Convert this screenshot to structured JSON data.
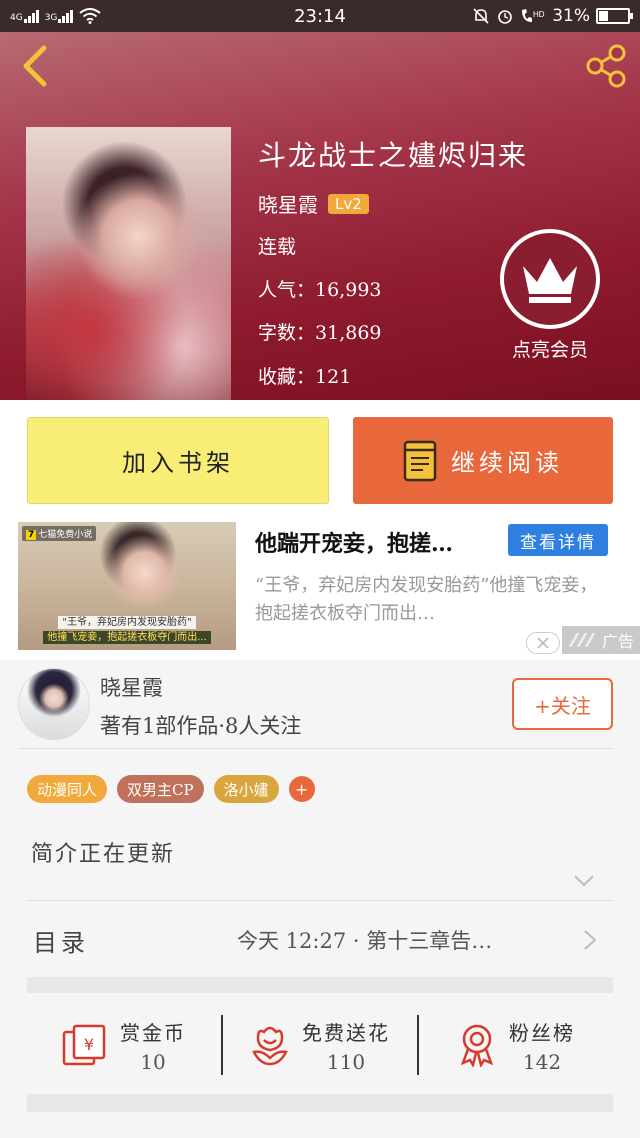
{
  "status_bar": {
    "time": "23:14",
    "net1": "4G",
    "net2": "3G",
    "battery": "31%"
  },
  "book": {
    "title": "斗龙战士之嫿烬归来",
    "author": "晓星霞",
    "level": "Lv2",
    "status": "连载",
    "popularity_label": "人气：",
    "popularity": "16,993",
    "words_label": "字数：",
    "words": "31,869",
    "favorites_label": "收藏：",
    "favorites": "121",
    "vip_label": "点亮会员"
  },
  "actions": {
    "shelf_label": "加入书架",
    "read_label": "继续阅读"
  },
  "ad": {
    "logo_text": "七猫免费小说",
    "caption_line1": "\"王爷，弃妃房内发现安胎药\"",
    "caption_line2": "他撞飞宠妾，抱起搓衣板夺门而出...",
    "title": "他踹开宠妾，抱搓…",
    "detail_label": "查看详情",
    "description": "“王爷，弃妃房内发现安胎药”他撞飞宠妾，抱起搓衣板夺门而出…",
    "tag": "广告"
  },
  "author_card": {
    "name": "晓星霞",
    "stats": "著有1部作品·8人关注",
    "follow_label": "+关注"
  },
  "tags": [
    {
      "label": "动漫同人",
      "color": "#f0a93a"
    },
    {
      "label": "双男主CP",
      "color": "#c0715c"
    },
    {
      "label": "洛小嫿",
      "color": "#d8a63c"
    }
  ],
  "tag_add": "+",
  "intro": "简介正在更新",
  "toc": {
    "label": "目录",
    "latest": "今天 12:27 · 第十三章告…"
  },
  "stats": [
    {
      "label": "赏金币",
      "value": "10",
      "icon": "red-envelope-icon"
    },
    {
      "label": "免费送花",
      "value": "110",
      "icon": "flower-icon"
    },
    {
      "label": "粉丝榜",
      "value": "142",
      "icon": "medal-icon"
    }
  ],
  "colors": {
    "accent": "#e8683b",
    "shelf": "#f9ee75",
    "header": "#8d1a2d",
    "ad_button": "#2d7fe0"
  }
}
